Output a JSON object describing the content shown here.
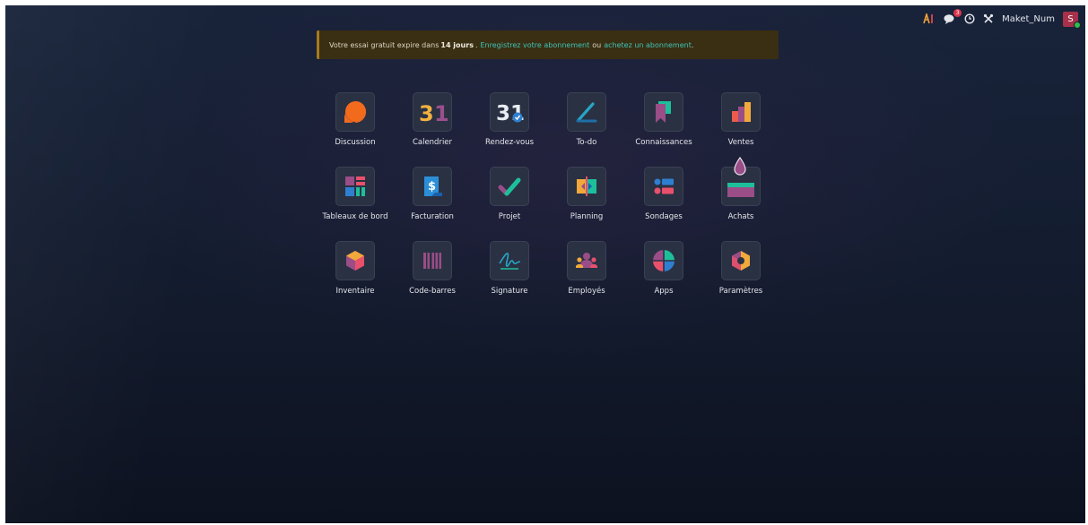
{
  "topbar": {
    "username": "Maket_Num",
    "avatar_letter": "S",
    "chat_badge": "3"
  },
  "banner": {
    "prefix": "Votre essai gratuit expire dans",
    "days": "14 jours",
    "after_days": ".",
    "register_link": "Enregistrez votre abonnement",
    "or": "ou",
    "buy_link": "achetez un abonnement",
    "end": "."
  },
  "apps": [
    {
      "name": "Discussion",
      "icon": "discussion-icon"
    },
    {
      "name": "Calendrier",
      "icon": "calendar-icon",
      "glyph": "31"
    },
    {
      "name": "Rendez-vous",
      "icon": "appointment-icon",
      "glyph": "31"
    },
    {
      "name": "To-do",
      "icon": "todo-icon"
    },
    {
      "name": "Connaissances",
      "icon": "knowledge-icon"
    },
    {
      "name": "Ventes",
      "icon": "sales-icon"
    },
    {
      "name": "Tableaux de bord",
      "icon": "dashboard-icon"
    },
    {
      "name": "Facturation",
      "icon": "invoicing-icon",
      "glyph": "$"
    },
    {
      "name": "Projet",
      "icon": "project-icon"
    },
    {
      "name": "Planning",
      "icon": "planning-icon"
    },
    {
      "name": "Sondages",
      "icon": "surveys-icon"
    },
    {
      "name": "Achats",
      "icon": "purchase-icon"
    },
    {
      "name": "Inventaire",
      "icon": "inventory-icon"
    },
    {
      "name": "Code-barres",
      "icon": "barcode-icon"
    },
    {
      "name": "Signature",
      "icon": "signature-icon"
    },
    {
      "name": "Employés",
      "icon": "employees-icon"
    },
    {
      "name": "Apps",
      "icon": "apps-icon"
    },
    {
      "name": "Paramètres",
      "icon": "settings-icon"
    }
  ],
  "colors": {
    "banner_bg": "#3a2f12",
    "banner_accent": "#a87a1c",
    "link": "#3fc2b8",
    "tile_bg": "#2a3143"
  }
}
